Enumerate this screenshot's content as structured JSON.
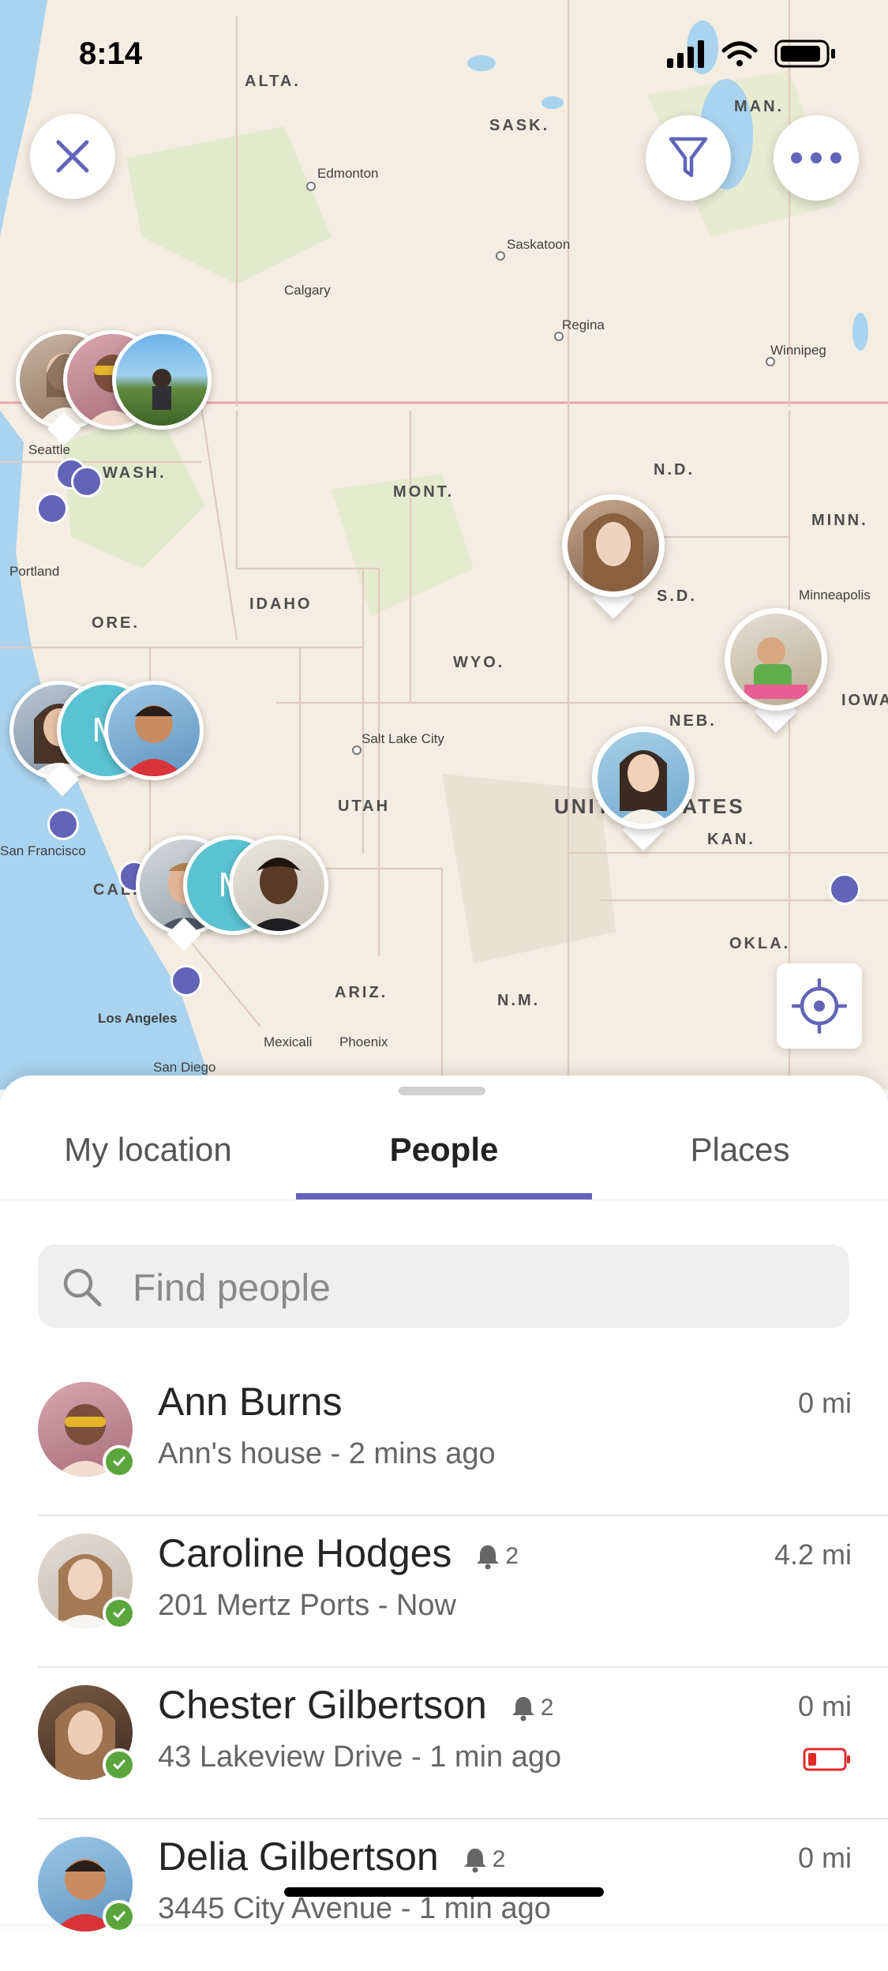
{
  "status_bar": {
    "time": "8:14"
  },
  "map": {
    "region_labels": [
      {
        "text": "ALTA."
      },
      {
        "text": "SASK."
      },
      {
        "text": "MAN."
      },
      {
        "text": "WASH."
      },
      {
        "text": "MONT."
      },
      {
        "text": "N.D."
      },
      {
        "text": "MINN."
      },
      {
        "text": "IDAHO"
      },
      {
        "text": "ORE."
      },
      {
        "text": "WYO."
      },
      {
        "text": "S.D."
      },
      {
        "text": "NEB."
      },
      {
        "text": "IOWA"
      },
      {
        "text": "UTAH"
      },
      {
        "text": "UNITED STATES"
      },
      {
        "text": "KAN."
      },
      {
        "text": "CALIF."
      },
      {
        "text": "ARIZ."
      },
      {
        "text": "N.M."
      },
      {
        "text": "OKLA."
      }
    ],
    "cities": [
      {
        "text": "Edmonton"
      },
      {
        "text": "Saskatoon"
      },
      {
        "text": "Calgary"
      },
      {
        "text": "Regina"
      },
      {
        "text": "Winnipeg"
      },
      {
        "text": "Seattle"
      },
      {
        "text": "Portland"
      },
      {
        "text": "Minneapolis"
      },
      {
        "text": "Salt Lake City"
      },
      {
        "text": "San Francisco"
      },
      {
        "text": "Los Angeles"
      },
      {
        "text": "Mexicali"
      },
      {
        "text": "Phoenix"
      },
      {
        "text": "San Diego"
      }
    ],
    "cluster_letters": [
      "M",
      "M"
    ],
    "buttons": {
      "close": "close-icon",
      "filter": "filter-icon",
      "more": "more-icon",
      "locate": "locate-icon"
    },
    "accent_color": "#6264B8"
  },
  "tabs": [
    {
      "label": "My location"
    },
    {
      "label": "People"
    },
    {
      "label": "Places"
    }
  ],
  "active_tab": "People",
  "search": {
    "placeholder": "Find people"
  },
  "people": [
    {
      "name": "Ann Burns",
      "subtitle": "Ann's house - 2 mins ago",
      "distance": "0 mi",
      "alerts": ""
    },
    {
      "name": "Caroline Hodges",
      "subtitle": "201 Mertz Ports - Now",
      "distance": "4.2 mi",
      "alerts": "2"
    },
    {
      "name": "Chester Gilbertson",
      "subtitle": "43 Lakeview Drive - 1 min ago",
      "distance": "0 mi",
      "alerts": "2",
      "battery": "low"
    },
    {
      "name": "Delia Gilbertson",
      "subtitle": "3445 City Avenue - 1 min ago",
      "distance": "0 mi",
      "alerts": "2"
    }
  ]
}
